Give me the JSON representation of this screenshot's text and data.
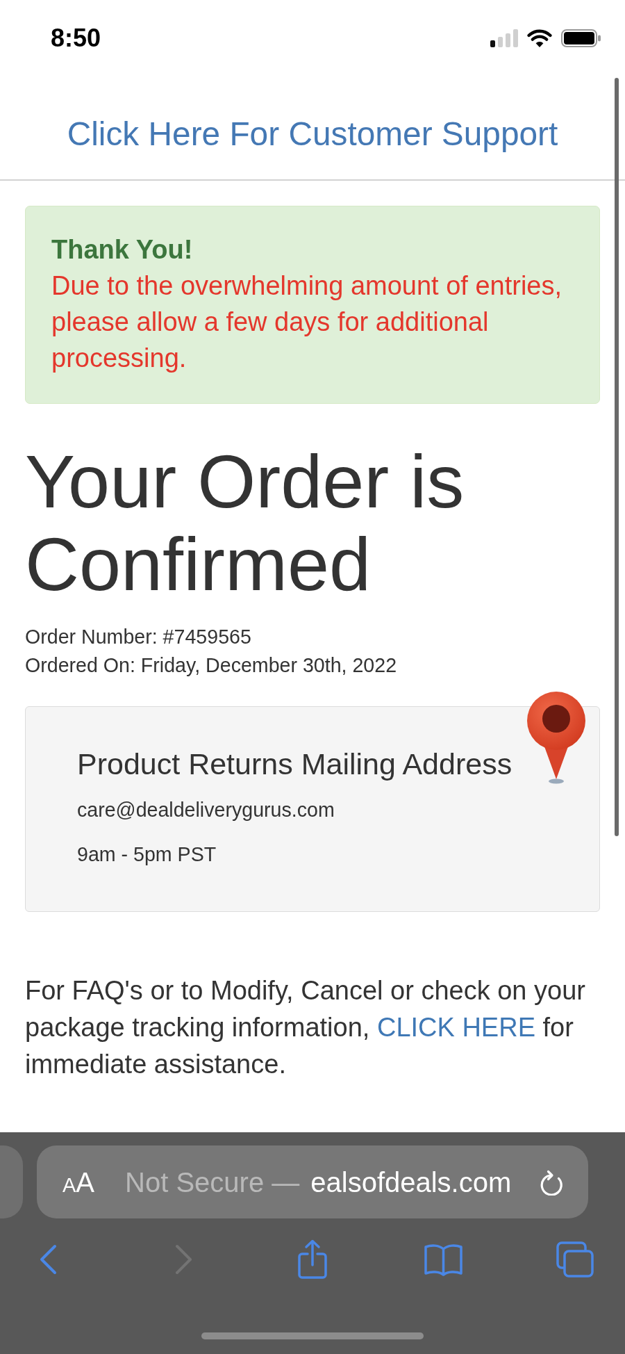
{
  "status_bar": {
    "time": "8:50"
  },
  "header": {
    "support_link": "Click Here For Customer Support"
  },
  "alert": {
    "title": "Thank You!",
    "message": "Due to the overwhelming amount of entries, please allow a few days for additional processing."
  },
  "heading": "Your Order is Confirmed",
  "order_details": [
    "Order Number: #7459565",
    "Ordered On: Friday, December 30th, 2022"
  ],
  "returns_card": {
    "title": "Product Returns Mailing Address",
    "lines": [
      "care@dealdeliverygurus.com",
      "9am - 5pm PST"
    ]
  },
  "faq_text": {
    "before": "For FAQ's or to Modify, Cancel or check on your package tracking information,",
    "link": "CLICK HERE",
    "after": "for immediate assistance."
  },
  "browser_bar": {
    "format_button": "AA",
    "security_label": "Not Secure —",
    "domain": "ealsofdeals.com"
  },
  "nav_buttons": [
    {
      "kind": "back",
      "disabled": false
    },
    {
      "kind": "forward",
      "disabled": true
    },
    {
      "kind": "share",
      "disabled": false
    },
    {
      "kind": "bookmarks",
      "disabled": false
    },
    {
      "kind": "tabs",
      "disabled": false
    }
  ]
}
